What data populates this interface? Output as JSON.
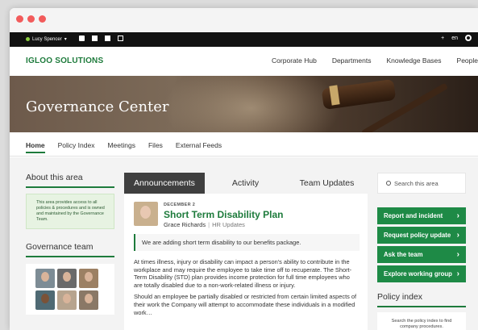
{
  "topbar": {
    "user_name": "Lucy Spencer",
    "user_caret": "▾",
    "plus": "+",
    "lang": "en",
    "icons": [
      "chat-icon",
      "check-icon",
      "calendar-icon",
      "document-icon",
      "gear-icon"
    ]
  },
  "brand": "IGLOO SOLUTIONS",
  "topnav": [
    "Corporate Hub",
    "Departments",
    "Knowledge Bases",
    "People"
  ],
  "hero": {
    "title": "Governance Center"
  },
  "subnav": [
    "Home",
    "Policy Index",
    "Meetings",
    "Files",
    "External Feeds"
  ],
  "sidebar": {
    "about_title": "About this area",
    "about_text": "This area provides access to all policies & procedures and is owned and maintained by the Governance Team.",
    "team_title": "Governance team"
  },
  "tabs": [
    "Announcements",
    "Activity",
    "Team Updates"
  ],
  "post": {
    "date": "DECEMBER 2",
    "title": "Short Term Disability Plan",
    "author": "Grace Richards",
    "separator": "|",
    "group": "HR Updates",
    "quote": "We are adding short term disability to our benefits package.",
    "para1": "At times illness, injury or disability can impact a person's ability to contribute in the workplace and may require the employee to take time off to recuperate. The Short-Term Disability (STD) plan provides income protection for full time employees who are totally disabled due to a non-work-related illness or injury.",
    "para2": "Should an employee be partially disabled or restricted from certain limited aspects of their work the Company will attempt to accommodate these individuals in a modified work…"
  },
  "right": {
    "search_placeholder": "Search this area",
    "actions": [
      "Report and incident",
      "Request policy update",
      "Ask the team",
      "Explore working group"
    ],
    "policy_title": "Policy index",
    "policy_text": "Search the policy index to find company procedures."
  },
  "colors": {
    "accent": "#1e7b3c",
    "button": "#1e8a46",
    "topbar": "#121212",
    "window_dots": "#f25b5b"
  }
}
